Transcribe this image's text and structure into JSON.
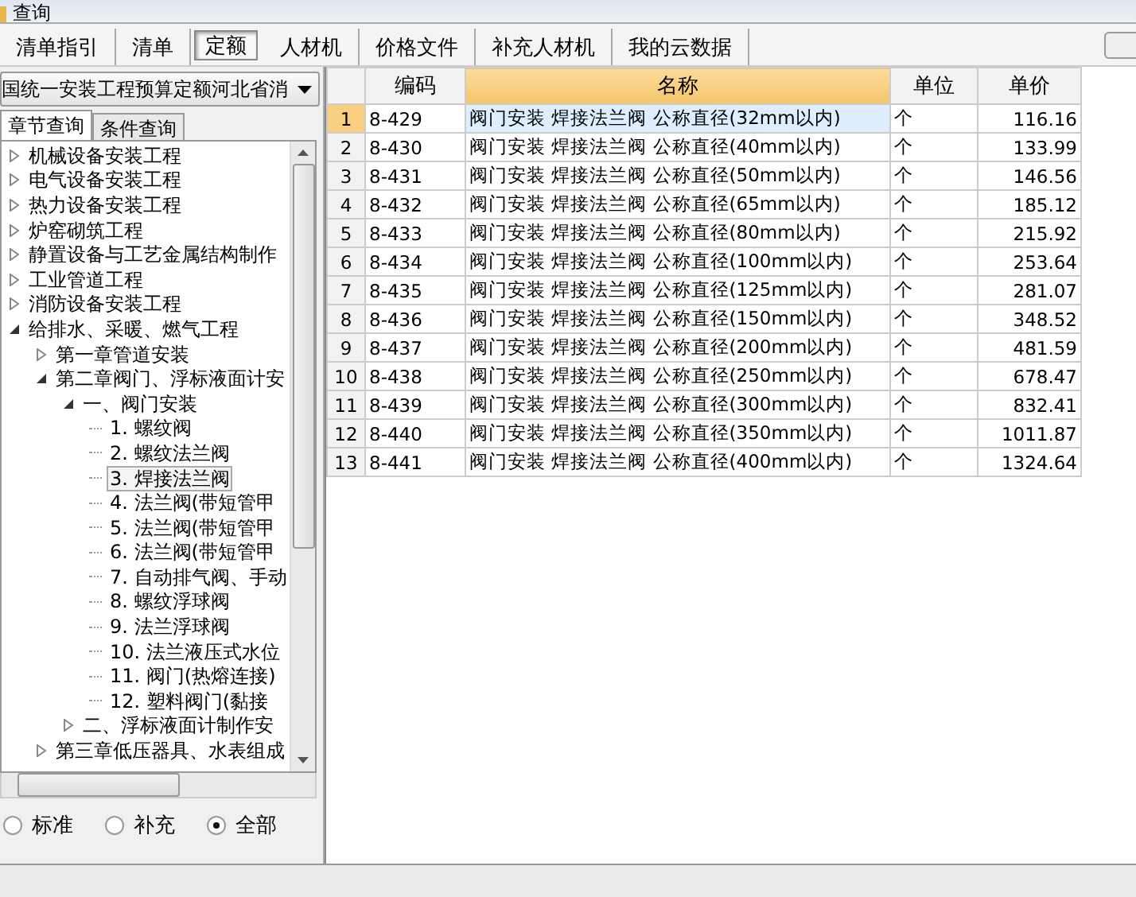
{
  "window": {
    "title": "查询"
  },
  "tabs": [
    {
      "label": "清单指引",
      "selected": false
    },
    {
      "label": "清单",
      "selected": false
    },
    {
      "label": "定额",
      "selected": true
    },
    {
      "label": "人材机",
      "selected": false
    },
    {
      "label": "价格文件",
      "selected": false
    },
    {
      "label": "补充人材机",
      "selected": false
    },
    {
      "label": "我的云数据",
      "selected": false
    }
  ],
  "library_dropdown": {
    "value": "国统一安装工程预算定额河北省消"
  },
  "query_tabs": [
    {
      "label": "章节查询",
      "selected": true
    },
    {
      "label": "条件查询",
      "selected": false
    }
  ],
  "tree": {
    "items": [
      {
        "label": "机械设备安装工程",
        "expanded": false,
        "selected": false
      },
      {
        "label": "电气设备安装工程",
        "expanded": false,
        "selected": false
      },
      {
        "label": "热力设备安装工程",
        "expanded": false,
        "selected": false
      },
      {
        "label": "炉窑砌筑工程",
        "expanded": false,
        "selected": false
      },
      {
        "label": "静置设备与工艺金属结构制作",
        "expanded": false,
        "selected": false
      },
      {
        "label": "工业管道工程",
        "expanded": false,
        "selected": false
      },
      {
        "label": "消防设备安装工程",
        "expanded": false,
        "selected": false
      },
      {
        "label": "给排水、采暖、燃气工程",
        "expanded": true,
        "selected": false,
        "children": [
          {
            "label": "第一章管道安装",
            "expanded": false,
            "selected": false
          },
          {
            "label": "第二章阀门、浮标液面计安",
            "expanded": true,
            "selected": false,
            "children": [
              {
                "label": "一、阀门安装",
                "expanded": true,
                "selected": false,
                "children": [
                  {
                    "label": "1. 螺纹阀",
                    "selected": false
                  },
                  {
                    "label": "2. 螺纹法兰阀",
                    "selected": false
                  },
                  {
                    "label": "3. 焊接法兰阀",
                    "selected": true
                  },
                  {
                    "label": "4. 法兰阀(带短管甲",
                    "selected": false
                  },
                  {
                    "label": "5. 法兰阀(带短管甲",
                    "selected": false
                  },
                  {
                    "label": "6. 法兰阀(带短管甲",
                    "selected": false
                  },
                  {
                    "label": "7. 自动排气阀、手动",
                    "selected": false
                  },
                  {
                    "label": "8. 螺纹浮球阀",
                    "selected": false
                  },
                  {
                    "label": "9. 法兰浮球阀",
                    "selected": false
                  },
                  {
                    "label": "10. 法兰液压式水位",
                    "selected": false
                  },
                  {
                    "label": "11. 阀门(热熔连接)",
                    "selected": false
                  },
                  {
                    "label": "12. 塑料阀门(黏接",
                    "selected": false
                  }
                ]
              },
              {
                "label": "二、浮标液面计制作安",
                "expanded": false,
                "selected": false
              }
            ]
          },
          {
            "label": "第三章低压器具、水表组成",
            "expanded": false,
            "selected": false
          }
        ]
      }
    ]
  },
  "filter": [
    {
      "label": "标准",
      "selected": false
    },
    {
      "label": "补充",
      "selected": false
    },
    {
      "label": "全部",
      "selected": true
    }
  ],
  "table": {
    "columns": [
      {
        "label": "编码",
        "selected": false
      },
      {
        "label": "名称",
        "selected": true
      },
      {
        "label": "单位",
        "selected": false
      },
      {
        "label": "单价",
        "selected": false
      }
    ],
    "rows": [
      {
        "index": "1",
        "code": "8-429",
        "name": "阀门安装 焊接法兰阀 公称直径(32mm以内)",
        "unit": "个",
        "price": "116.16",
        "selected": true
      },
      {
        "index": "2",
        "code": "8-430",
        "name": "阀门安装 焊接法兰阀 公称直径(40mm以内)",
        "unit": "个",
        "price": "133.99",
        "selected": false
      },
      {
        "index": "3",
        "code": "8-431",
        "name": "阀门安装 焊接法兰阀 公称直径(50mm以内)",
        "unit": "个",
        "price": "146.56",
        "selected": false
      },
      {
        "index": "4",
        "code": "8-432",
        "name": "阀门安装 焊接法兰阀 公称直径(65mm以内)",
        "unit": "个",
        "price": "185.12",
        "selected": false
      },
      {
        "index": "5",
        "code": "8-433",
        "name": "阀门安装 焊接法兰阀 公称直径(80mm以内)",
        "unit": "个",
        "price": "215.92",
        "selected": false
      },
      {
        "index": "6",
        "code": "8-434",
        "name": "阀门安装 焊接法兰阀 公称直径(100mm以内)",
        "unit": "个",
        "price": "253.64",
        "selected": false
      },
      {
        "index": "7",
        "code": "8-435",
        "name": "阀门安装 焊接法兰阀 公称直径(125mm以内)",
        "unit": "个",
        "price": "281.07",
        "selected": false
      },
      {
        "index": "8",
        "code": "8-436",
        "name": "阀门安装 焊接法兰阀 公称直径(150mm以内)",
        "unit": "个",
        "price": "348.52",
        "selected": false
      },
      {
        "index": "9",
        "code": "8-437",
        "name": "阀门安装 焊接法兰阀 公称直径(200mm以内)",
        "unit": "个",
        "price": "481.59",
        "selected": false
      },
      {
        "index": "10",
        "code": "8-438",
        "name": "阀门安装 焊接法兰阀 公称直径(250mm以内)",
        "unit": "个",
        "price": "678.47",
        "selected": false
      },
      {
        "index": "11",
        "code": "8-439",
        "name": "阀门安装 焊接法兰阀 公称直径(300mm以内)",
        "unit": "个",
        "price": "832.41",
        "selected": false
      },
      {
        "index": "12",
        "code": "8-440",
        "name": "阀门安装 焊接法兰阀 公称直径(350mm以内)",
        "unit": "个",
        "price": "1011.87",
        "selected": false
      },
      {
        "index": "13",
        "code": "8-441",
        "name": "阀门安装 焊接法兰阀 公称直径(400mm以内)",
        "unit": "个",
        "price": "1324.64",
        "selected": false
      }
    ]
  }
}
